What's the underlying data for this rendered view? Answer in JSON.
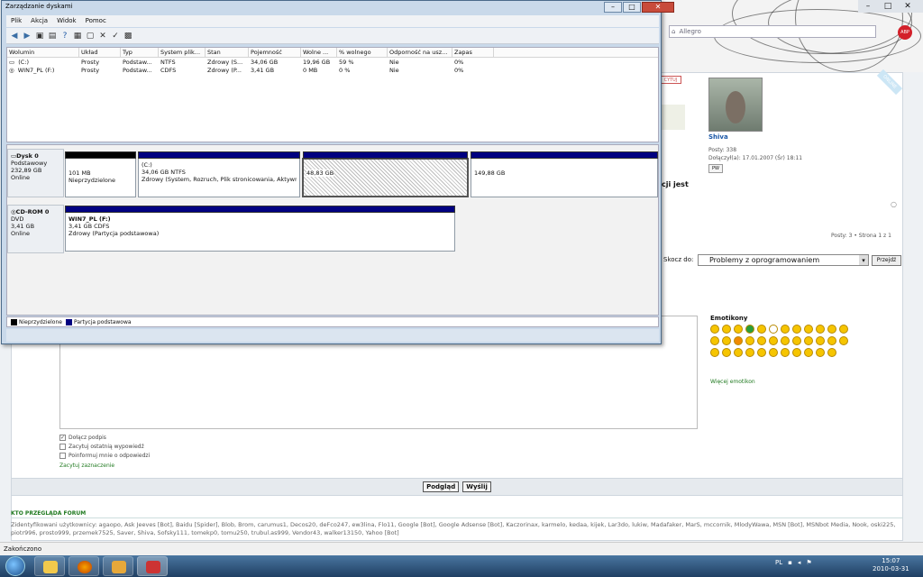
{
  "window": {
    "title": "Zarządzanie dyskami",
    "menu": [
      "Plik",
      "Akcja",
      "Widok",
      "Pomoc"
    ],
    "controls": {
      "minimize": "–",
      "maximize": "□",
      "close": "✕"
    }
  },
  "volumes": {
    "columns": [
      "Wolumin",
      "Układ",
      "Typ",
      "System plik...",
      "Stan",
      "Pojemność",
      "Wolne ...",
      "% wolnego",
      "Odporność na usz...",
      "Zapas"
    ],
    "rows": [
      [
        "(C:)",
        "Prosty",
        "Podstaw...",
        "NTFS",
        "Zdrowy (S...",
        "34,06 GB",
        "19,96 GB",
        "59 %",
        "Nie",
        "0%"
      ],
      [
        "WIN7_PL (F:)",
        "Prosty",
        "Podstaw...",
        "CDFS",
        "Zdrowy (P...",
        "3,41 GB",
        "0 MB",
        "0 %",
        "Nie",
        "0%"
      ]
    ]
  },
  "disk0": {
    "name": "Dysk 0",
    "type": "Podstawowy",
    "size": "232,89 GB",
    "status": "Online",
    "partitions": [
      {
        "label": "",
        "size": "101 MB",
        "desc": "Nieprzydzielone"
      },
      {
        "label": "(C:)",
        "size": "34,06 GB NTFS",
        "desc": "Zdrowy (System, Rozruch, Plik stronicowania, Aktywn"
      },
      {
        "label": "",
        "size": "48,83 GB",
        "desc": ""
      },
      {
        "label": "",
        "size": "149,88 GB",
        "desc": ""
      }
    ]
  },
  "cdrom0": {
    "name": "CD-ROM 0",
    "type": "DVD",
    "size": "3,41 GB",
    "status": "Online",
    "partition": {
      "label": "WIN7_PL (F:)",
      "size": "3,41 GB CDFS",
      "desc": "Zdrowy (Partycja podstawowa)"
    }
  },
  "legend": {
    "unallocated": "Nieprzydzielone",
    "primary": "Partycja podstawowa",
    "colors": {
      "unallocated": "#000000",
      "primary": "#000080"
    }
  },
  "browser": {
    "address": "Allegro",
    "status": "Zakończono",
    "window_controls": [
      "–",
      "□",
      "✕"
    ]
  },
  "forum": {
    "cytuj": "CYTUJ",
    "online": "ONLINE",
    "author": "Shiva",
    "posty": "Posty: 338",
    "dolaczyl": "Dołączył(a): 17.01.2007 (Śr) 18:11",
    "pw": "PW",
    "cji_jest": "cji jest",
    "stats": "Posty: 3 • Strona 1 z 1",
    "skocz_do": "Skocz do:",
    "jump_value": "Problemy z oprogramowaniem",
    "przejdz": "Przejdź",
    "emotikony": "Emotikony",
    "wiecej": "Więcej emotikon",
    "checks": [
      "Dołącz podpis",
      "Zacytuj ostatnią wypowiedź",
      "Poinformuj mnie o odpowiedzi"
    ],
    "zacytuj": "Zacytuj zaznaczenie",
    "podglad": "Podgląd",
    "wyslij": "Wyślij",
    "kto": "KTO PRZEGLĄDA FORUM",
    "users": "Zidentyfikowani użytkownicy: agaopo, Ask Jeeves [Bot], Baidu [Spider], Blob, Brom, carumus1, Decos20, deFco247, ew3lina, Flo11, Google [Bot], Google Adsense [Bot], Kaczorinax, karmelo, kedaa, kijek, Lar3do, lukiw, Madafaker, MarS, mccornik, MlodyWawa, MSN [Bot], MSNbot Media, Nook, oski225, piotr996, prosto999, przemek7525, Saver, Shiva, Sofsky111, tomekp0, tomu250, trubul.as999, Vendor43, walker13150, Yahoo [Bot]"
  },
  "taskbar": {
    "lang": "PL",
    "time": "15:07",
    "date": "2010-03-31"
  }
}
